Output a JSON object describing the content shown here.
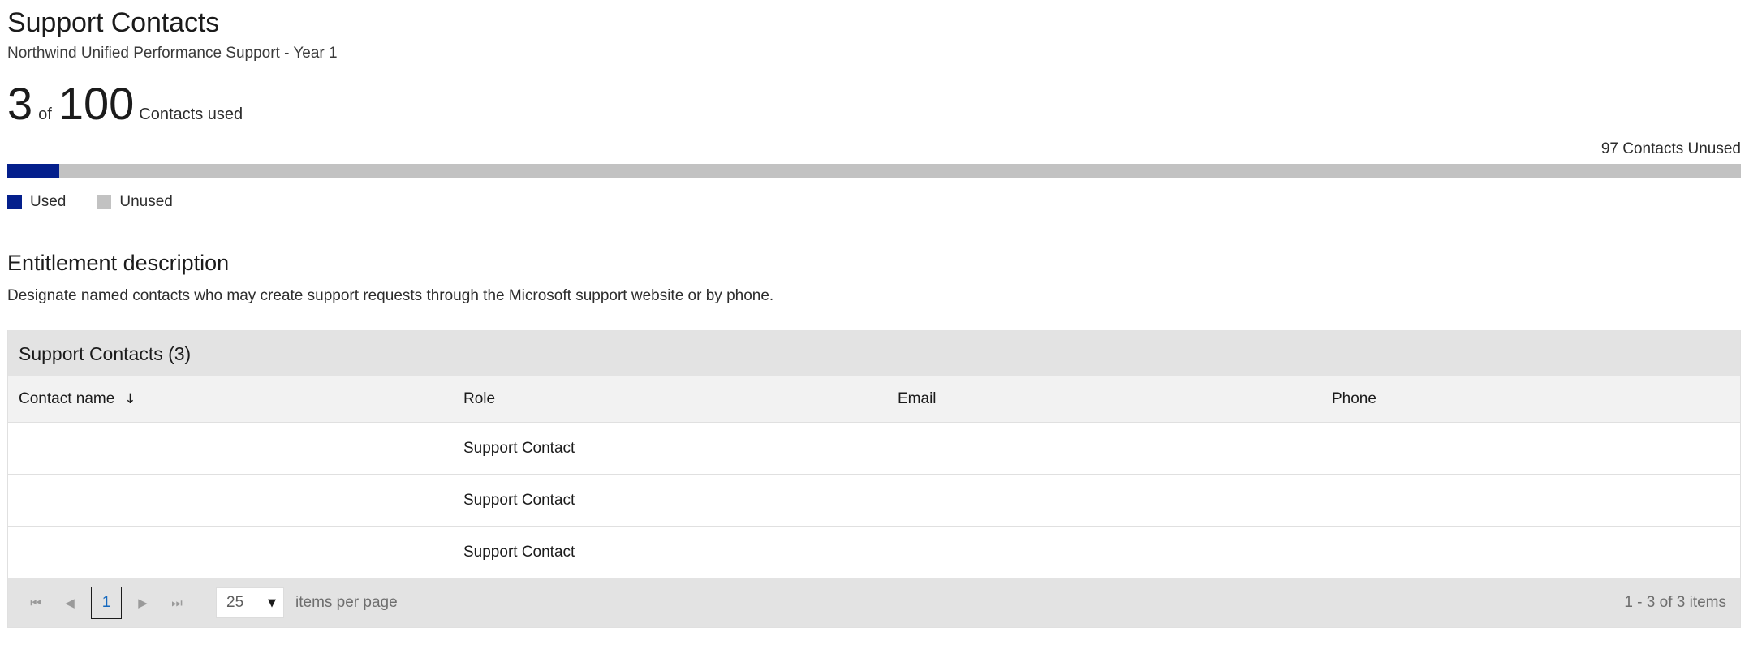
{
  "header": {
    "title": "Support Contacts",
    "subtitle": "Northwind Unified Performance Support - Year 1"
  },
  "usage": {
    "used": "3",
    "of": "of",
    "total": "100",
    "caption": "Contacts used",
    "unused_label": "97 Contacts Unused",
    "used_count": 3,
    "total_count": 100,
    "unused_count": 97,
    "percent_used": 3,
    "used_color": "#041f8c",
    "unused_color": "#c2c2c2"
  },
  "legend": {
    "items": [
      {
        "label": "Used",
        "color": "#041f8c"
      },
      {
        "label": "Unused",
        "color": "#c2c2c2"
      }
    ]
  },
  "entitlement": {
    "heading": "Entitlement description",
    "description": "Designate named contacts who may create support requests through the Microsoft support website or by phone."
  },
  "grid": {
    "toolbar_title": "Support Contacts (3)",
    "columns": [
      {
        "label": "Contact name",
        "sort": "↓"
      },
      {
        "label": "Role",
        "sort": ""
      },
      {
        "label": "Email",
        "sort": ""
      },
      {
        "label": "Phone",
        "sort": ""
      }
    ],
    "rows": [
      {
        "name": "",
        "role": "Support Contact",
        "email": "",
        "phone": ""
      },
      {
        "name": "",
        "role": "Support Contact",
        "email": "",
        "phone": ""
      },
      {
        "name": "",
        "role": "Support Contact",
        "email": "",
        "phone": ""
      }
    ],
    "pager": {
      "first_icon": "⏮",
      "prev_icon": "◀",
      "current_page": "1",
      "next_icon": "▶",
      "last_icon": "⏭",
      "page_size": "25",
      "page_size_caret": "▼",
      "items_per_page_label": "items per page",
      "summary": "1 - 3 of 3 items"
    }
  }
}
